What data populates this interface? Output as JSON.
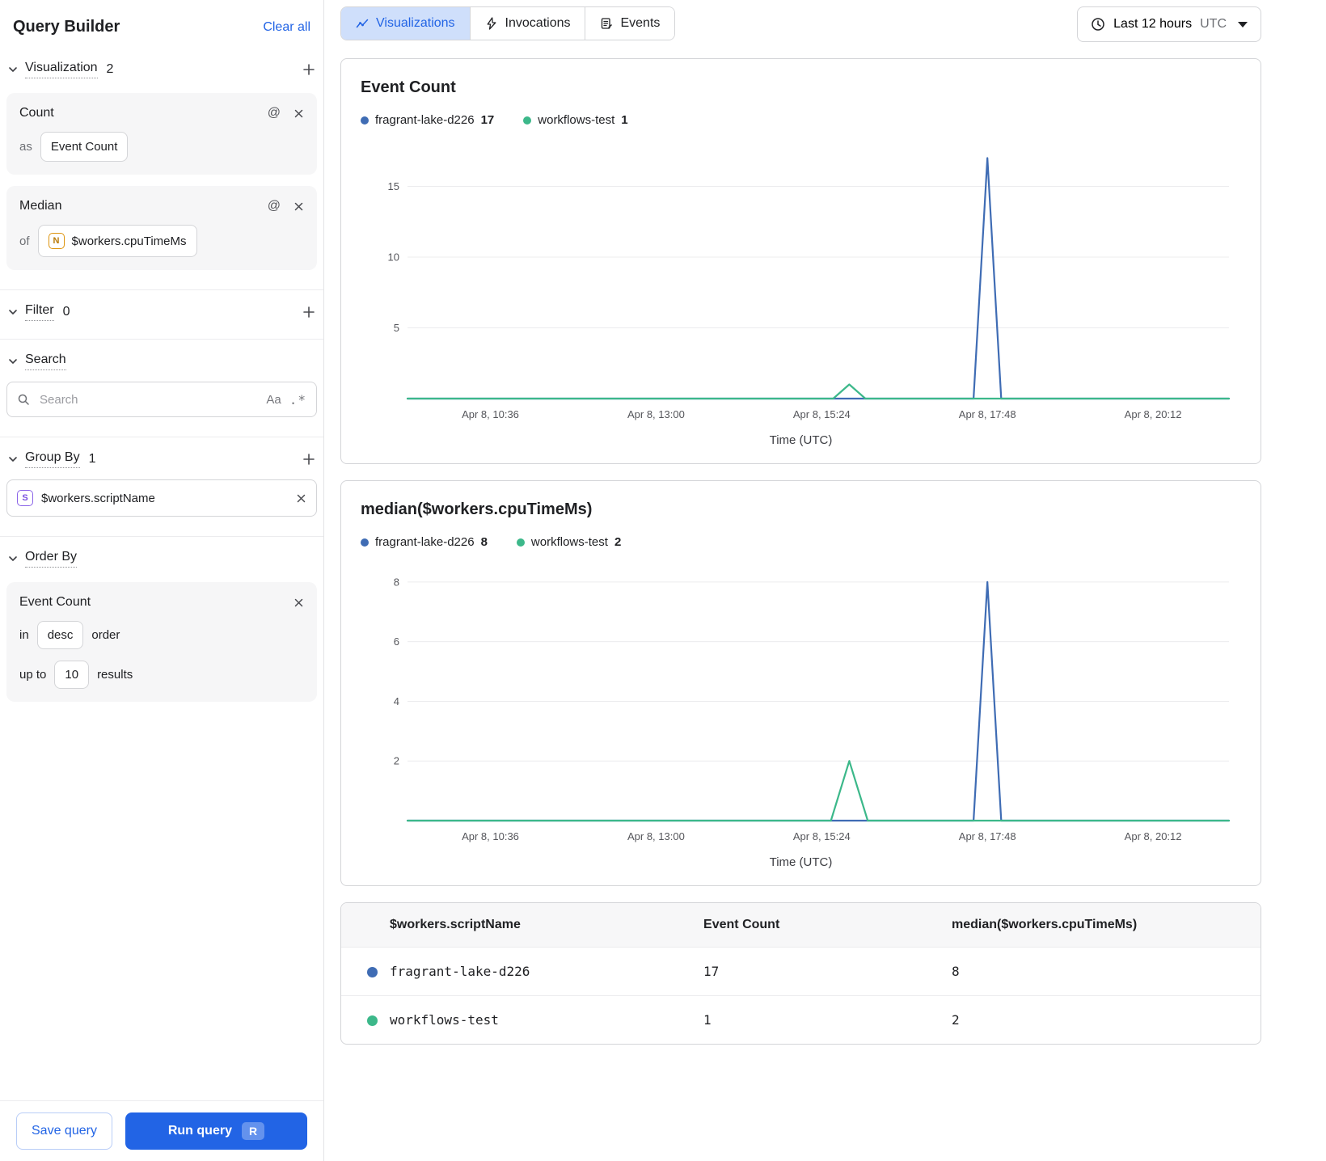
{
  "colors": {
    "accent": "#2264e5",
    "series_blue": "#3f6cb4",
    "series_green": "#3cb88a",
    "tab_active_bg": "#cfdffb"
  },
  "sidebar": {
    "title": "Query Builder",
    "clear_all": "Clear all",
    "visualization": {
      "label": "Visualization",
      "count": "2"
    },
    "viz_cards": [
      {
        "title": "Count",
        "prefix": "as",
        "value": "Event Count"
      },
      {
        "title": "Median",
        "prefix": "of",
        "value": "$workers.cpuTimeMs",
        "value_icon": "N"
      }
    ],
    "filter": {
      "label": "Filter",
      "count": "0"
    },
    "search": {
      "label": "Search",
      "placeholder": "Search",
      "match_case_icon": "Aa",
      "regex_icon": ".*"
    },
    "group_by": {
      "label": "Group By",
      "count": "1",
      "value": "$workers.scriptName",
      "value_icon": "S"
    },
    "order_by": {
      "label": "Order By",
      "field": "Event Count",
      "in_label": "in",
      "direction": "desc",
      "order_label": "order",
      "up_to_label": "up to",
      "limit": "10",
      "results_label": "results"
    },
    "footer": {
      "save_label": "Save query",
      "run_label": "Run query",
      "run_shortcut": "R"
    }
  },
  "topbar": {
    "tabs": [
      {
        "label": "Visualizations",
        "icon": "chart-line-icon",
        "active": true
      },
      {
        "label": "Invocations",
        "icon": "lightning-icon",
        "active": false
      },
      {
        "label": "Events",
        "icon": "events-icon",
        "active": false
      }
    ],
    "time_range": {
      "label": "Last 12 hours",
      "zone": "UTC"
    }
  },
  "chart_data": [
    {
      "type": "line",
      "title": "Event Count",
      "xlabel": "Time (UTC)",
      "legend": [
        {
          "name": "fragrant-lake-d226",
          "value": 17,
          "color": "#3f6cb4"
        },
        {
          "name": "workflows-test",
          "value": 1,
          "color": "#3cb88a"
        }
      ],
      "ylim": [
        0,
        17.6
      ],
      "yticks": [
        5,
        10,
        15
      ],
      "xdomain": [
        0,
        714
      ],
      "xticks": [
        {
          "m": 72,
          "label": "Apr 8, 10:36"
        },
        {
          "m": 216,
          "label": "Apr 8, 13:00"
        },
        {
          "m": 360,
          "label": "Apr 8, 15:24"
        },
        {
          "m": 504,
          "label": "Apr 8, 17:48"
        },
        {
          "m": 648,
          "label": "Apr 8, 20:12"
        }
      ],
      "series": [
        {
          "name": "fragrant-lake-d226",
          "color": "#3f6cb4",
          "points": [
            [
              0,
              0
            ],
            [
              492,
              0
            ],
            [
              504,
              17
            ],
            [
              516,
              0
            ],
            [
              714,
              0
            ]
          ]
        },
        {
          "name": "workflows-test",
          "color": "#3cb88a",
          "points": [
            [
              0,
              0
            ],
            [
              370,
              0
            ],
            [
              384,
              1
            ],
            [
              398,
              0
            ],
            [
              714,
              0
            ]
          ]
        }
      ]
    },
    {
      "type": "line",
      "title": "median($workers.cpuTimeMs)",
      "xlabel": "Time (UTC)",
      "legend": [
        {
          "name": "fragrant-lake-d226",
          "value": 8,
          "color": "#3f6cb4"
        },
        {
          "name": "workflows-test",
          "value": 2,
          "color": "#3cb88a"
        }
      ],
      "ylim": [
        0,
        8.35
      ],
      "yticks": [
        2,
        4,
        6,
        8
      ],
      "xdomain": [
        0,
        714
      ],
      "xticks": [
        {
          "m": 72,
          "label": "Apr 8, 10:36"
        },
        {
          "m": 216,
          "label": "Apr 8, 13:00"
        },
        {
          "m": 360,
          "label": "Apr 8, 15:24"
        },
        {
          "m": 504,
          "label": "Apr 8, 17:48"
        },
        {
          "m": 648,
          "label": "Apr 8, 20:12"
        }
      ],
      "series": [
        {
          "name": "fragrant-lake-d226",
          "color": "#3f6cb4",
          "points": [
            [
              0,
              0
            ],
            [
              492,
              0
            ],
            [
              504,
              8
            ],
            [
              516,
              0
            ],
            [
              714,
              0
            ]
          ]
        },
        {
          "name": "workflows-test",
          "color": "#3cb88a",
          "points": [
            [
              0,
              0
            ],
            [
              368,
              0
            ],
            [
              384,
              2
            ],
            [
              400,
              0
            ],
            [
              714,
              0
            ]
          ]
        }
      ]
    }
  ],
  "table": {
    "columns": [
      "$workers.scriptName",
      "Event Count",
      "median($workers.cpuTimeMs)"
    ],
    "rows": [
      {
        "color": "#3f6cb4",
        "cells": [
          "fragrant-lake-d226",
          "17",
          "8"
        ]
      },
      {
        "color": "#3cb88a",
        "cells": [
          "workflows-test",
          "1",
          "2"
        ]
      }
    ]
  }
}
